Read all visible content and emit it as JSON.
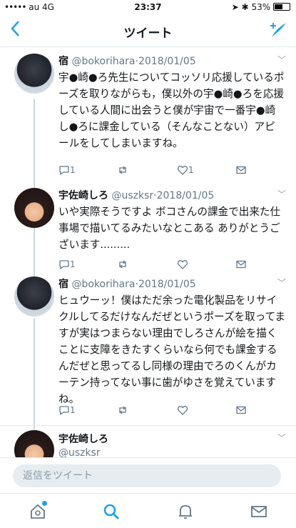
{
  "status_bar": {
    "carrier": "au",
    "network": "4G",
    "time": "23:37",
    "battery": "53%"
  },
  "header": {
    "back_icon": "chevron-left-icon",
    "title": "ツイート",
    "compose_icon": "compose-icon"
  },
  "tweets": [
    {
      "name": "宿",
      "handle": "@bokorihara",
      "date": "2018/01/05",
      "text": "宇●崎●ろ先生についてコッソリ応援しているポーズを取りながらも，僕以外の宇●崎●ろを応援している人間に出会うと僕が宇宙で一番宇●崎し●ろに課金している（そんなことない）アピールをしてしまいますね。",
      "reply_count": "1",
      "like_count": "1"
    },
    {
      "name": "宇佐崎しろ",
      "handle": "@uszksr",
      "date": "2018/01/05",
      "text": "いや実際そうですよ ボコさんの課金で出来た仕事場で描いてるみたいなとこある ありがとうございます.........",
      "reply_count": "1",
      "like_count": ""
    },
    {
      "name": "宿",
      "handle": "@bokorihara",
      "date": "2018/01/05",
      "text": "ヒュウーッ！僕はただ余った電化製品をリサイクルしてるだけなんだぜというポーズを取ってますが実はつまらない理由でしろさんが絵を描くことに支障をきたすくらいなら何でも課金するんだぜと思ってるし同様の理由でろのくんがカーテン持ってない事に歯がゆさを覚えていますね。",
      "reply_count": "1",
      "like_count": ""
    },
    {
      "name": "宇佐崎しろ",
      "handle": "@uszksr",
      "date": "",
      "text": "",
      "reply_count": "",
      "like_count": ""
    }
  ],
  "reply_bar": {
    "placeholder": "返信をツイート"
  },
  "tab_bar": {
    "items": [
      "home-icon",
      "search-icon",
      "notifications-icon",
      "messages-icon"
    ],
    "accent": "#1da1f2"
  }
}
